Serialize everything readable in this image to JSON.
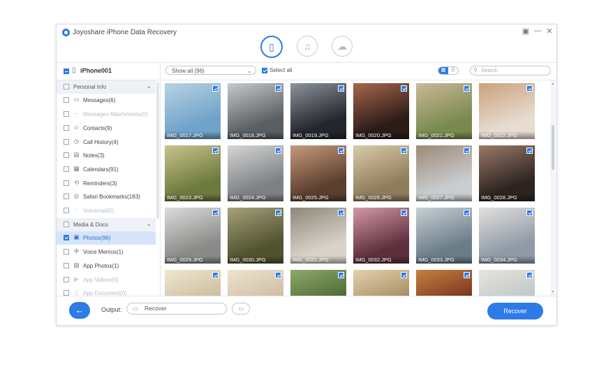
{
  "app": {
    "title": "Joyoshare iPhone Data Recovery",
    "accent_color": "#2d7be6",
    "window_controls": [
      "restore-icon",
      "minimize-icon",
      "close-icon"
    ],
    "modes": [
      {
        "name": "recover-from-ios-device",
        "icon": "phone-icon",
        "active": true
      },
      {
        "name": "recover-from-itunes",
        "icon": "music-note-icon",
        "active": false
      },
      {
        "name": "recover-from-icloud",
        "icon": "cloud-icon",
        "active": false
      }
    ]
  },
  "device": {
    "name": "iPhone001"
  },
  "toolbar": {
    "filter_value": "Show all (96)",
    "select_all_label": "Select all",
    "view_mode": "grid",
    "search_placeholder": "Search"
  },
  "sidebar": {
    "sections": [
      {
        "label": "Personal Info",
        "items": [
          {
            "label": "Messages(6)",
            "icon": "message-icon",
            "enabled": true
          },
          {
            "label": "Messages Attachments(0)",
            "icon": "paperclip-icon",
            "enabled": false
          },
          {
            "label": "Contacts(9)",
            "icon": "person-icon",
            "enabled": true
          },
          {
            "label": "Call History(4)",
            "icon": "clock-icon",
            "enabled": true
          },
          {
            "label": "Notes(3)",
            "icon": "note-icon",
            "enabled": true
          },
          {
            "label": "Calendars(91)",
            "icon": "calendar-icon",
            "enabled": true
          },
          {
            "label": "Reminders(3)",
            "icon": "reminder-icon",
            "enabled": true
          },
          {
            "label": "Safari Bookmarks(183)",
            "icon": "compass-icon",
            "enabled": true
          },
          {
            "label": "Voicemail(0)",
            "icon": "microphone-icon",
            "enabled": false
          }
        ]
      },
      {
        "label": "Media & Docs",
        "items": [
          {
            "label": "Photos(96)",
            "icon": "photo-icon",
            "enabled": true,
            "active": true,
            "checked": true
          },
          {
            "label": "Voice Memos(1)",
            "icon": "waveform-icon",
            "enabled": true
          },
          {
            "label": "App Photos(1)",
            "icon": "image-icon",
            "enabled": true
          },
          {
            "label": "App Videos(0)",
            "icon": "video-icon",
            "enabled": false
          },
          {
            "label": "App Document(0)",
            "icon": "document-icon",
            "enabled": false
          }
        ]
      }
    ]
  },
  "photos": [
    "IMG_0017.JPG",
    "IMG_0018.JPG",
    "IMG_0019.JPG",
    "IMG_0020.JPG",
    "IMG_0021.JPG",
    "IMG_0022.JPG",
    "IMG_0023.JPG",
    "IMG_0024.JPG",
    "IMG_0025.JPG",
    "IMG_0026.JPG",
    "IMG_0027.JPG",
    "IMG_0028.JPG",
    "IMG_0029.JPG",
    "IMG_0030.JPG",
    "IMG_0031.JPG",
    "IMG_0032.JPG",
    "IMG_0033.JPG",
    "IMG_0034.JPG",
    "",
    "",
    "",
    "",
    "",
    ""
  ],
  "photo_palettes": [
    [
      "#6fa3c9",
      "#b9d2e4"
    ],
    [
      "#5a5f63",
      "#c7c9cc"
    ],
    [
      "#23262b",
      "#8d949c"
    ],
    [
      "#2b1c18",
      "#a8674d"
    ],
    [
      "#7a8a4e",
      "#c9b99a"
    ],
    [
      "#e7dcd0",
      "#c9a27c"
    ],
    [
      "#6c7a3e",
      "#c9c38e"
    ],
    [
      "#7d8185",
      "#d5d6d4"
    ],
    [
      "#5b3f2e",
      "#c79a7d"
    ],
    [
      "#8e7d5c",
      "#d9caa8"
    ],
    [
      "#c9cdd0",
      "#9d8a75"
    ],
    [
      "#2d2420",
      "#9b7a68"
    ],
    [
      "#8a8a88",
      "#dcdcdc"
    ],
    [
      "#51522f",
      "#a5a17b"
    ],
    [
      "#d8d3c9",
      "#8f8679"
    ],
    [
      "#5e2f3d",
      "#d498a7"
    ],
    [
      "#6b7c89",
      "#c8cfd4"
    ],
    [
      "#8e9aa6",
      "#e2e0dc"
    ],
    [
      "#c4b796",
      "#f0e7d0"
    ],
    [
      "#c8b79c",
      "#f0e4cf"
    ],
    [
      "#43602f",
      "#8fa96a"
    ],
    [
      "#a08258",
      "#e4d2ae"
    ],
    [
      "#6e2a1c",
      "#c7813f"
    ],
    [
      "#b8c2c6",
      "#e8e4dc"
    ]
  ],
  "bottom": {
    "output_label": "Output:",
    "output_value": "Recover",
    "recover_label": "Recover"
  }
}
